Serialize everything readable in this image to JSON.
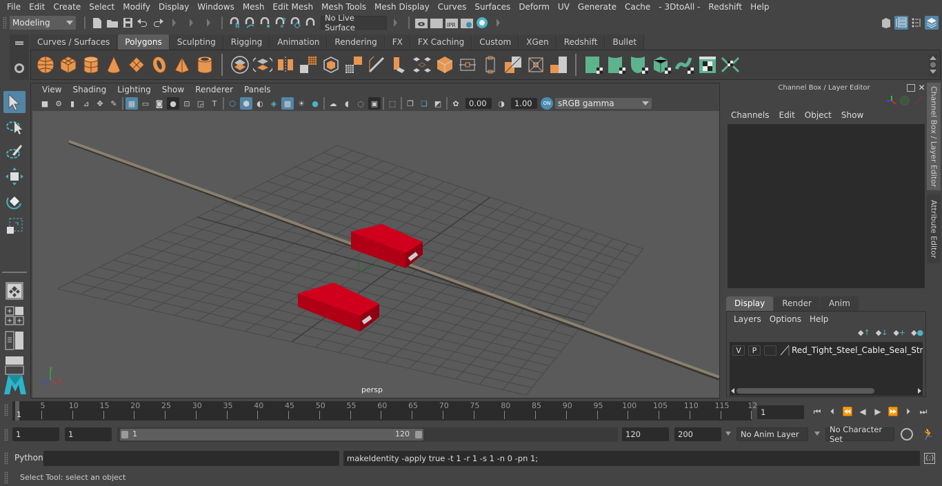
{
  "menubar": {
    "items": [
      "File",
      "Edit",
      "Create",
      "Select",
      "Modify",
      "Display",
      "Windows",
      "Mesh",
      "Edit Mesh",
      "Mesh Tools",
      "Mesh Display",
      "Curves",
      "Surfaces",
      "Deform",
      "UV",
      "Generate",
      "Cache",
      "- 3DtoAll -",
      "Redshift",
      "Help"
    ]
  },
  "statusline": {
    "workspace": "Modeling",
    "live_surface": "No Live Surface",
    "icons": [
      "new-scene-icon",
      "open-scene-icon",
      "save-scene-icon",
      "undo-icon",
      "redo-icon",
      "snap-grid-icon",
      "snap-curve-icon",
      "snap-point-icon",
      "snap-view-plane-icon",
      "snap-live-icon",
      "make-live-icon",
      "render-view-icon",
      "render-frame-icon",
      "ipr-render-icon",
      "render-settings-icon",
      "hypershade-icon"
    ],
    "right_icons": [
      "modeling-toolkit-icon",
      "attribute-editor-toggle-icon",
      "tool-settings-toggle-icon",
      "channel-box-toggle-icon"
    ]
  },
  "shelf": {
    "tabs": [
      "Curves / Surfaces",
      "Polygons",
      "Sculpting",
      "Rigging",
      "Animation",
      "Rendering",
      "FX",
      "FX Caching",
      "Custom",
      "XGen",
      "Redshift",
      "Bullet"
    ],
    "active_tab": "Polygons",
    "polygon_primitives": [
      "poly-sphere-icon",
      "poly-cube-icon",
      "poly-cylinder-icon",
      "poly-cone-icon",
      "poly-plane-icon",
      "poly-torus-icon",
      "poly-pyramid-icon",
      "poly-pipe-icon"
    ],
    "mesh_tools": [
      "combine-icon",
      "separate-icon",
      "mirror-icon",
      "smooth-icon",
      "extract-icon",
      "bevel-icon",
      "multi-cut-icon",
      "extrude-icon",
      "bridge-icon",
      "append-icon",
      "insert-edge-loop-icon",
      "offset-edge-loop-icon",
      "merge-icon",
      "target-weld-icon",
      "fill-hole-icon"
    ],
    "uv_tools": [
      "planar-uv-icon",
      "cylindrical-uv-icon",
      "spherical-uv-icon",
      "automatic-uv-icon",
      "unfold-uv-icon",
      "uv-editor-icon",
      "uv-layout-icon"
    ]
  },
  "toolbox": {
    "tools": [
      "select-tool-icon",
      "lasso-tool-icon",
      "paint-select-tool-icon",
      "move-tool-icon",
      "rotate-tool-icon",
      "scale-tool-icon"
    ],
    "layouts": [
      "single-perspective-layout-icon",
      "four-view-layout-icon",
      "outliner-persp-layout-icon",
      "persp-graph-layout-icon"
    ]
  },
  "viewport": {
    "menu": [
      "View",
      "Shading",
      "Lighting",
      "Show",
      "Renderer",
      "Panels"
    ],
    "exposure": "0.00",
    "gamma": "1.00",
    "color_space": "sRGB gamma",
    "camera_label": "persp",
    "axis_labels": {
      "x": "x",
      "y": "y",
      "z": "z"
    },
    "colors": {
      "background": "#5a5a5a",
      "grid": "#4a4a4a",
      "seal": "#c8001a",
      "cable": "#8a8070"
    }
  },
  "channel_box": {
    "title": "Channel Box / Layer Editor",
    "menu": [
      "Channels",
      "Edit",
      "Object",
      "Show"
    ]
  },
  "layer_editor": {
    "tabs": [
      "Display",
      "Render",
      "Anim"
    ],
    "active_tab": "Display",
    "menu": [
      "Layers",
      "Options",
      "Help"
    ],
    "layers": [
      {
        "visible": "V",
        "playback": "P",
        "name": "Red_Tight_Steel_Cable_Seal_Straight"
      }
    ]
  },
  "side_tabs": [
    "Channel Box / Layer Editor",
    "Attribute Editor"
  ],
  "timeline": {
    "ticks": [
      "5",
      "10",
      "15",
      "20",
      "25",
      "30",
      "35",
      "40",
      "45",
      "50",
      "55",
      "60",
      "65",
      "70",
      "75",
      "80",
      "85",
      "90",
      "95",
      "100",
      "105",
      "110",
      "115",
      "12"
    ],
    "current_frame_marker": "1",
    "current_frame": "1"
  },
  "range": {
    "start_time": "1",
    "playback_start": "1",
    "slider_start": "1",
    "slider_end": "120",
    "playback_end": "120",
    "end_time": "200",
    "anim_layer": "No Anim Layer",
    "character_set": "No Character Set"
  },
  "command": {
    "language": "Python",
    "input": "",
    "last_result": "makeIdentity -apply true -t 1 -r 1 -s 1 -n 0 -pn 1;"
  },
  "helpline": {
    "text": "Select Tool: select an object"
  }
}
